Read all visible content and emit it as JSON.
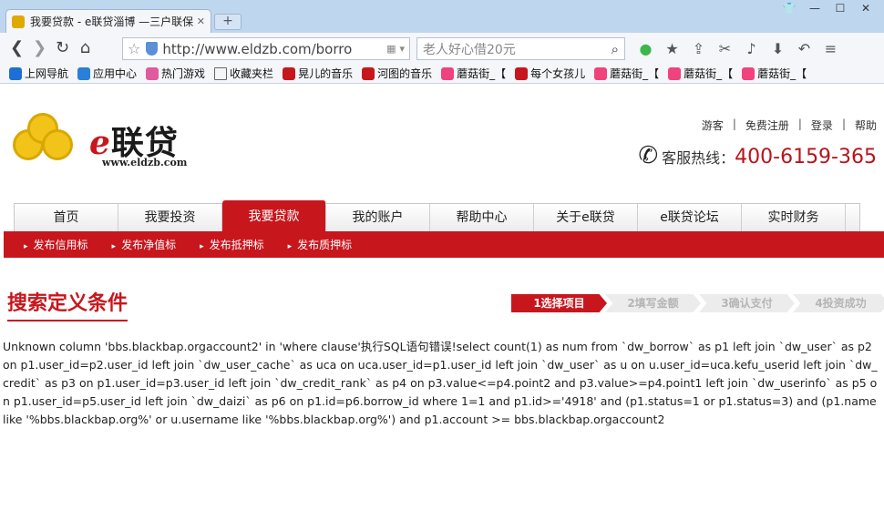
{
  "browser": {
    "tab_title": "我要贷款 - e联贷淄博 —三户联保",
    "address": "http://www.eldzb.com/borro",
    "search_placeholder": "老人好心借20元",
    "bookmarks": [
      {
        "label": "上网导航",
        "color": "#1d6fd4"
      },
      {
        "label": "应用中心",
        "color": "#2a7fd9"
      },
      {
        "label": "热门游戏",
        "color": "#e05a9e"
      },
      {
        "label": "收藏夹栏",
        "color": "#f4f6f9"
      },
      {
        "label": "晃儿的音乐",
        "color": "#c8161d"
      },
      {
        "label": "河图的音乐",
        "color": "#c8161d"
      },
      {
        "label": "蘑菇街_【",
        "color": "#f0427d"
      },
      {
        "label": "每个女孩儿",
        "color": "#c8161d"
      },
      {
        "label": "蘑菇街_【",
        "color": "#f0427d"
      },
      {
        "label": "蘑菇街_【",
        "color": "#f0427d"
      },
      {
        "label": "蘑菇街_【",
        "color": "#f0427d"
      }
    ]
  },
  "header": {
    "logo_text": "联贷",
    "logo_e": "e",
    "logo_url": "www.eldzb.com",
    "links": [
      "游客",
      "免费注册",
      "登录",
      "帮助"
    ],
    "hotline_label": "客服热线：",
    "hotline_number": "400-6159-365"
  },
  "nav": {
    "items": [
      "首页",
      "我要投资",
      "我要贷款",
      "我的账户",
      "帮助中心",
      "关于e联贷",
      "e联贷论坛",
      "实时财务"
    ],
    "active": "我要贷款",
    "sub_items": [
      "发布信用标",
      "发布净值标",
      "发布抵押标",
      "发布质押标"
    ]
  },
  "main": {
    "section_title": "搜索定义条件",
    "steps": [
      "1选择项目",
      "2填写金额",
      "3确认支付",
      "4投资成功"
    ],
    "error_text": "Unknown column 'bbs.blackbap.orgaccount2' in 'where clause'执行SQL语句错误!select count(1) as num from `dw_borrow` as p1 left join `dw_user` as p2 on p1.user_id=p2.user_id left join `dw_user_cache` as uca on uca.user_id=p1.user_id left join `dw_user` as u on u.user_id=uca.kefu_userid left join `dw_credit` as p3 on p1.user_id=p3.user_id left join `dw_credit_rank` as p4 on p3.value<=p4.point2 and p3.value>=p4.point1 left join `dw_userinfo` as p5 on p1.user_id=p5.user_id left join `dw_daizi` as p6 on p1.id=p6.borrow_id where 1=1 and p1.id>='4918' and (p1.status=1 or p1.status=3) and (p1.name like '%bbs.blackbap.org%' or u.username like '%bbs.blackbap.org%') and p1.account >= bbs.blackbap.orgaccount2"
  }
}
